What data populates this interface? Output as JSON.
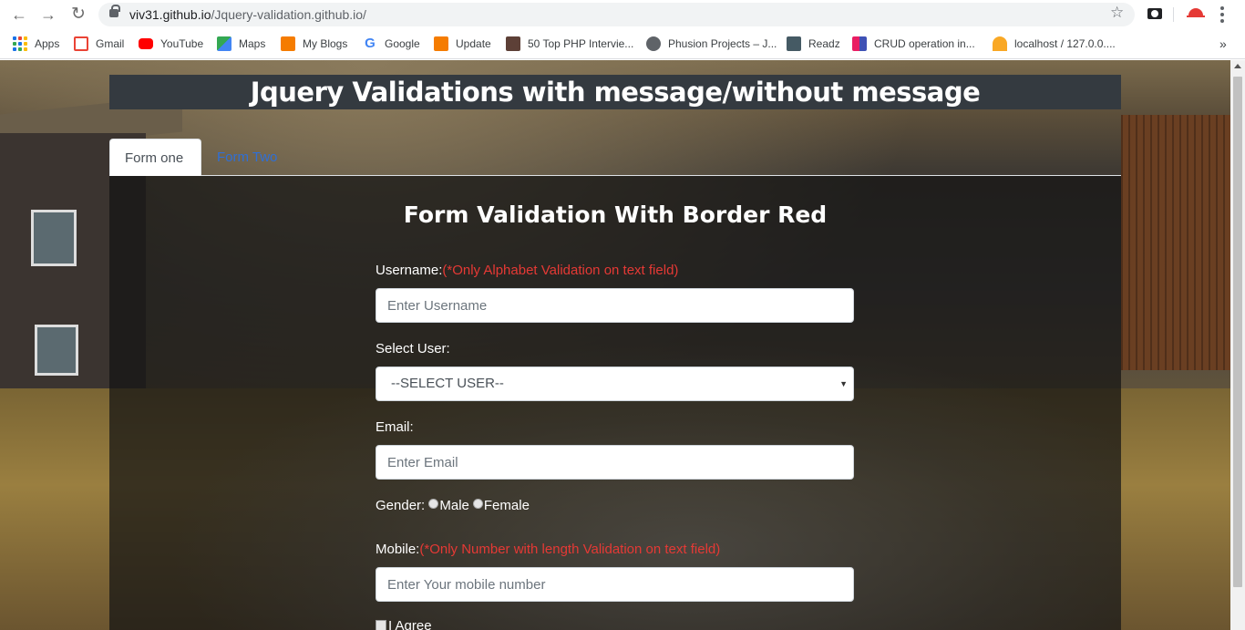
{
  "browser": {
    "url_host": "viv31.github.io",
    "url_path": "/Jquery-validation.github.io/"
  },
  "bookmarks": [
    {
      "label": "Apps",
      "icon": "apps-grid-icon",
      "color": "#1a73e8"
    },
    {
      "label": "Gmail",
      "icon": "gmail-icon",
      "color": "#ea4335"
    },
    {
      "label": "YouTube",
      "icon": "youtube-icon",
      "color": "#ff0000"
    },
    {
      "label": "Maps",
      "icon": "maps-icon",
      "color": "#34a853"
    },
    {
      "label": "My Blogs",
      "icon": "blogger-icon",
      "color": "#f57c00"
    },
    {
      "label": "Google",
      "icon": "google-icon",
      "color": "#4285f4"
    },
    {
      "label": "Update",
      "icon": "blogger-icon",
      "color": "#f57c00"
    },
    {
      "label": "50 Top PHP Intervie...",
      "icon": "php-icon",
      "color": "#5d4037"
    },
    {
      "label": "Phusion Projects – J...",
      "icon": "globe-icon",
      "color": "#5f6368"
    },
    {
      "label": "Readz",
      "icon": "readz-icon",
      "color": "#455a64"
    },
    {
      "label": "CRUD operation in...",
      "icon": "crud-icon",
      "color": "#e91e63"
    },
    {
      "label": "localhost / 127.0.0....",
      "icon": "phpmyadmin-icon",
      "color": "#f9a825"
    }
  ],
  "page": {
    "banner_title": "Jquery Validations with message/without message",
    "tabs": [
      "Form one",
      "Form Two"
    ],
    "form_title": "Form Validation With Border Red",
    "username": {
      "label": "Username:",
      "hint": "(*Only Alphabet Validation on text field)",
      "placeholder": "Enter Username"
    },
    "select_user": {
      "label": "Select User:",
      "selected": "--SELECT USER--"
    },
    "email": {
      "label": "Email:",
      "placeholder": "Enter Email"
    },
    "gender": {
      "label": "Gender:",
      "options": [
        "Male",
        "Female"
      ]
    },
    "mobile": {
      "label": "Mobile:",
      "hint": "(*Only Number with length Validation on text field)",
      "placeholder": "Enter Your mobile number"
    },
    "agree_label": "I Agree"
  }
}
